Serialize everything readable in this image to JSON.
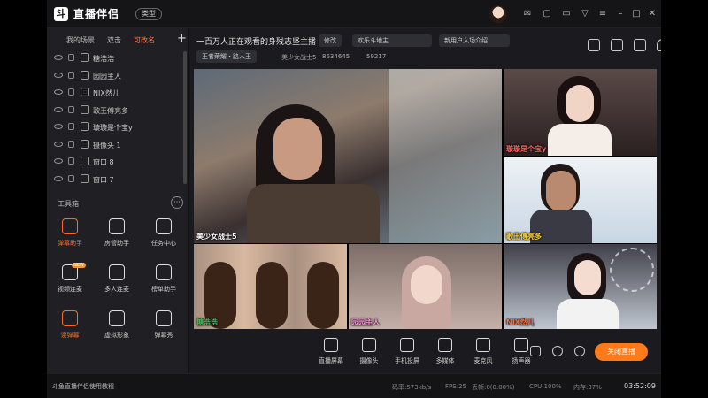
{
  "app": {
    "title": "直播伴侣",
    "type_button": "类型",
    "logo_char": "斗"
  },
  "left_tabs": [
    {
      "label": "我的场景",
      "active": false
    },
    {
      "label": "双击",
      "active": false
    },
    {
      "label": "可改名",
      "active": true
    }
  ],
  "sources": [
    {
      "label": "糖浩浩",
      "kind": "scene-link-icon"
    },
    {
      "label": "园园主人",
      "kind": "scene-link-icon"
    },
    {
      "label": "NIX然儿",
      "kind": "scene-link-icon"
    },
    {
      "label": "歌王傅亮多",
      "kind": "scene-link-icon"
    },
    {
      "label": "璇璇是个宝y",
      "kind": "scene-link-icon"
    },
    {
      "label": "摄像头 1",
      "kind": "camera-icon"
    },
    {
      "label": "窗口 8",
      "kind": "window-icon"
    },
    {
      "label": "窗口 7",
      "kind": "window-icon"
    }
  ],
  "tools_title": "工具箱",
  "tools": [
    {
      "label": "弹幕助手",
      "active": true
    },
    {
      "label": "房管助手",
      "active": false
    },
    {
      "label": "任务中心",
      "active": false
    },
    {
      "label": "视频连麦",
      "active": false,
      "badge": "NEW"
    },
    {
      "label": "多人连麦",
      "active": false
    },
    {
      "label": "榜单助手",
      "active": false
    },
    {
      "label": "读弹幕",
      "active": true
    },
    {
      "label": "虚拟形象",
      "active": false
    },
    {
      "label": "弹幕秀",
      "active": false
    }
  ],
  "stream": {
    "title": "一百万人正在观看的身残志坚主播",
    "edit_label": "修改",
    "pill1": "欢乐斗地主",
    "pill2": "新用户入场介绍",
    "channel": "王者荣耀・路人王",
    "host": "美少女战士5",
    "room_id": "8634645",
    "fans": "59217"
  },
  "cells": [
    {
      "name": "美少女战士5"
    },
    {
      "name": "璇璇是个宝y"
    },
    {
      "name": "歌王傅亮多"
    },
    {
      "name": "糖浩浩"
    },
    {
      "name": "园园主人"
    },
    {
      "name": "NIX然儿"
    }
  ],
  "bottom_bar": [
    {
      "label": "直播屏幕"
    },
    {
      "label": "摄像头"
    },
    {
      "label": "手机投屏"
    },
    {
      "label": "多媒体"
    },
    {
      "label": "麦克风"
    },
    {
      "label": "扬声器"
    }
  ],
  "live_button": "关闭直播",
  "status": {
    "tutorial": "斗鱼直播伴侣使用教程",
    "bitrate": "码率:573kb/s",
    "fps": "FPS:25",
    "drop": "丢帧:0(0.00%)",
    "cpu": "CPU:100%",
    "mem": "内存:37%",
    "clock": "03:52:09"
  },
  "colors": {
    "accent": "#ff7a1a",
    "bg": "#1b1b1f"
  }
}
